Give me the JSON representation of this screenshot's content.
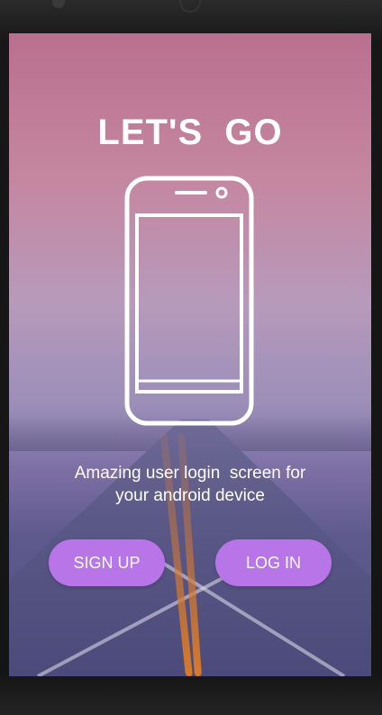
{
  "screen": {
    "title": "LET'S  GO",
    "tagline_line1": "Amazing user login  screen for",
    "tagline_line2": "your android device"
  },
  "buttons": {
    "signup_label": "SIGN UP",
    "login_label": "LOG IN"
  },
  "icons": {
    "hero": "smartphone-outline-icon"
  },
  "colors": {
    "button": "#b775e8",
    "text": "#ffffff",
    "background_top": "#b9708f",
    "background_bottom": "#4e4e80"
  }
}
